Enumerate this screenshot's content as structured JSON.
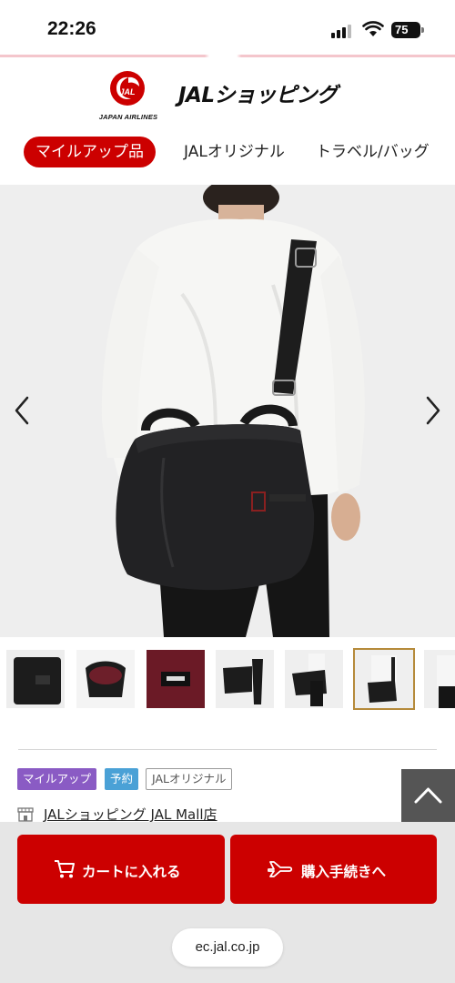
{
  "status_bar": {
    "time": "22:26",
    "battery": "75"
  },
  "header": {
    "logo_subtext": "JAPAN AIRLINES",
    "site_title": "JALショッピング",
    "brand_color": "#cc0000"
  },
  "category_nav": {
    "items": [
      {
        "label": "マイルアップ品",
        "active": true
      },
      {
        "label": "JALオリジナル",
        "active": false
      },
      {
        "label": "トラベル/バッグ",
        "active": false
      }
    ]
  },
  "gallery": {
    "prev_icon": "chevron-left-icon",
    "next_icon": "chevron-right-icon",
    "thumbnail_count": 7,
    "selected_thumbnail": 6
  },
  "product": {
    "tags": [
      "マイルアップ",
      "予約",
      "JALオリジナル"
    ],
    "shop_name": "JALショッピング JAL Mall店"
  },
  "actions": {
    "cart_label": "カートに入れる",
    "checkout_label": "購入手続きへ"
  },
  "browser": {
    "url": "ec.jal.co.jp"
  }
}
